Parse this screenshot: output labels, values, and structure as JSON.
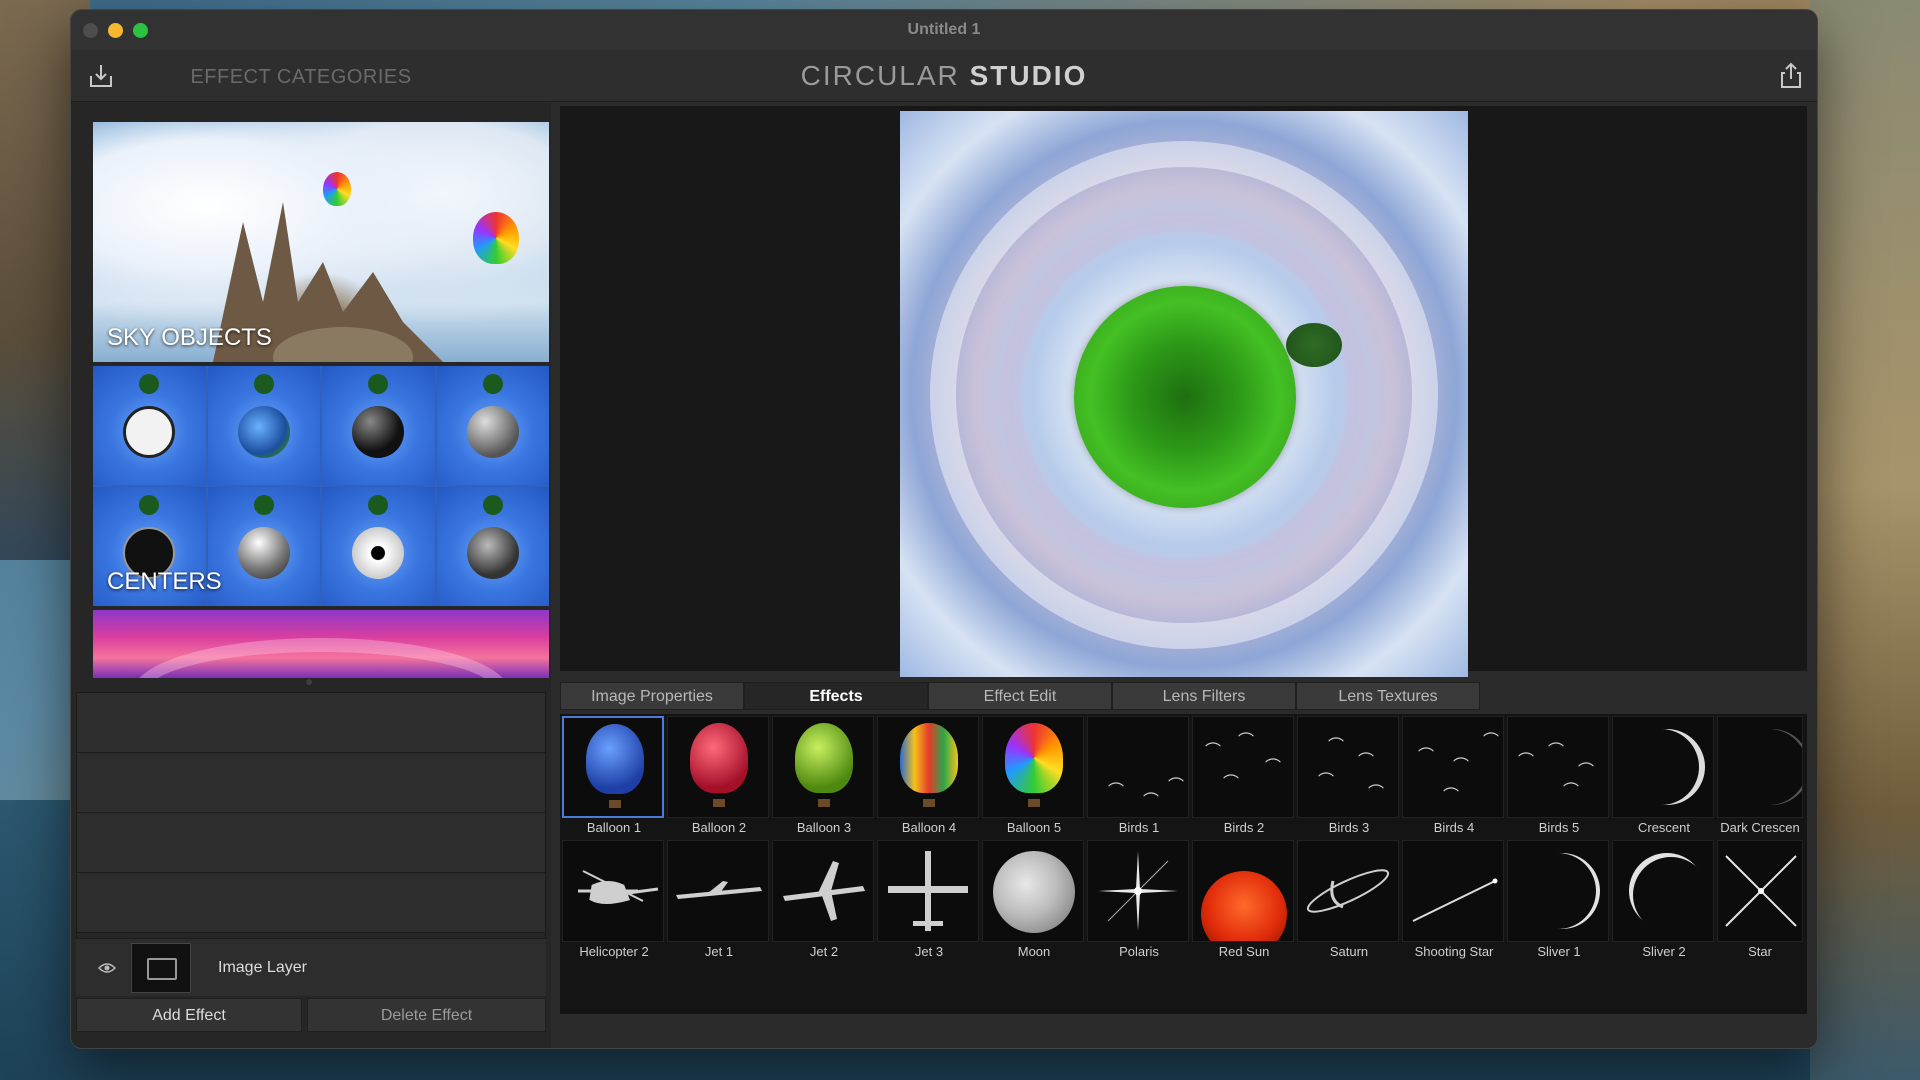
{
  "window": {
    "title": "Untitled 1"
  },
  "toolbar": {
    "categories_heading": "EFFECT CATEGORIES",
    "brand_part1": "CIRCULAR",
    "brand_part2": "STUDIO",
    "import_icon": "import-icon",
    "share_icon": "share-icon"
  },
  "categories": [
    {
      "label": "SKY OBJECTS"
    },
    {
      "label": "CENTERS"
    },
    {
      "label": ""
    }
  ],
  "layers": {
    "image_layer_label": "Image Layer",
    "add_effect": "Add Effect",
    "delete_effect": "Delete Effect"
  },
  "tabs": [
    "Image Properties",
    "Effects",
    "Effect Edit",
    "Lens Filters",
    "Lens Textures"
  ],
  "active_tab": "Effects",
  "effects_row1": [
    "Balloon 1",
    "Balloon 2",
    "Balloon 3",
    "Balloon 4",
    "Balloon 5",
    "Birds 1",
    "Birds 2",
    "Birds 3",
    "Birds 4",
    "Birds 5",
    "Crescent",
    "Dark Crescen"
  ],
  "effects_row2": [
    "Helicopter 2",
    "Jet 1",
    "Jet 2",
    "Jet 3",
    "Moon",
    "Polaris",
    "Red Sun",
    "Saturn",
    "Shooting Star",
    "Sliver 1",
    "Sliver 2",
    "Star"
  ],
  "colors": {
    "selection": "#4b7bd8",
    "traffic_min": "#f5b82e",
    "traffic_max": "#2bc341"
  }
}
